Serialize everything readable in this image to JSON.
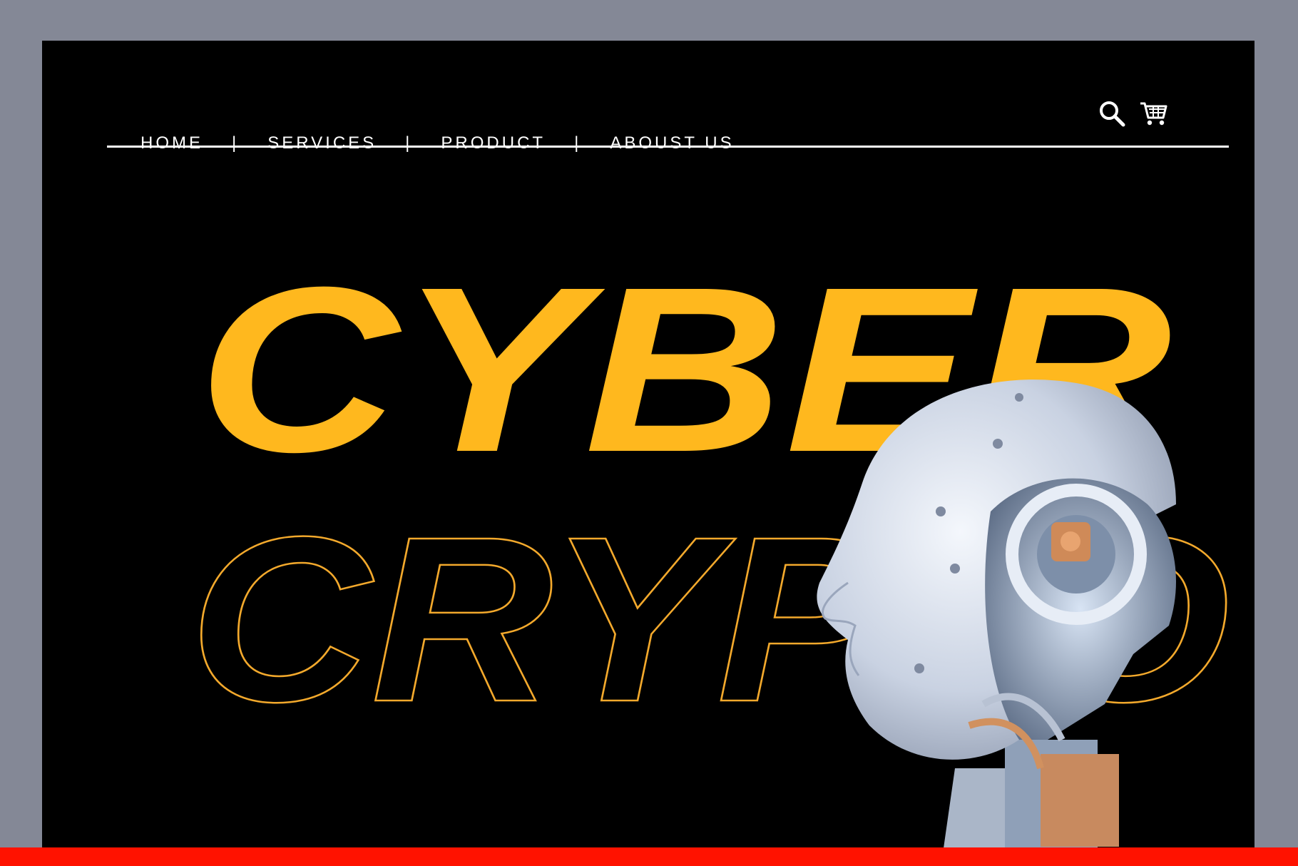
{
  "nav": {
    "items": [
      {
        "label": "HOME"
      },
      {
        "label": "SERVICES"
      },
      {
        "label": "PRODUCT"
      },
      {
        "label": "ABOUST US"
      }
    ],
    "separator": "|"
  },
  "header_icons": [
    "search-icon",
    "cart-icon"
  ],
  "hero": {
    "title_line1": "CYBER",
    "title_line2": "CRYPTO"
  },
  "colors": {
    "background": "#848896",
    "panel": "#000000",
    "accent": "#FFB81E",
    "outline": "#F3A92C",
    "bottom_bar": "#FF1200"
  }
}
